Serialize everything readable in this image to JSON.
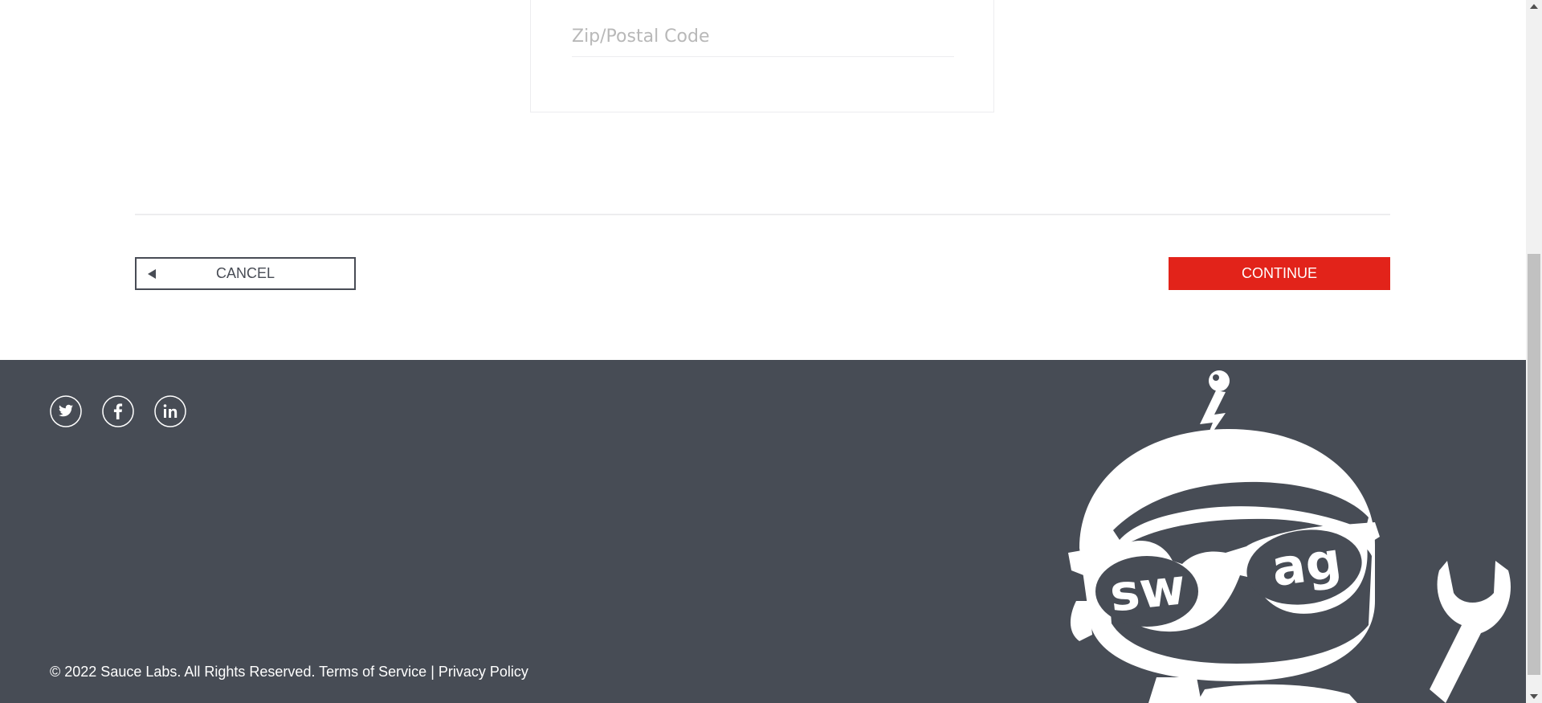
{
  "checkout_form": {
    "zip_placeholder": "Zip/Postal Code",
    "zip_value": ""
  },
  "actions": {
    "cancel_label": "CANCEL",
    "continue_label": "CONTINUE"
  },
  "footer": {
    "social_links": [
      {
        "name": "twitter-icon"
      },
      {
        "name": "facebook-icon"
      },
      {
        "name": "linkedin-icon"
      }
    ],
    "copyright_text": "© 2022 Sauce Labs. All Rights Reserved.",
    "terms_label": "Terms of Service",
    "separator": "|",
    "privacy_label": "Privacy Policy",
    "logo_text": "swag"
  },
  "colors": {
    "accent": "#e2231a",
    "footer_bg": "#474c55",
    "text_dark": "#484c55"
  }
}
